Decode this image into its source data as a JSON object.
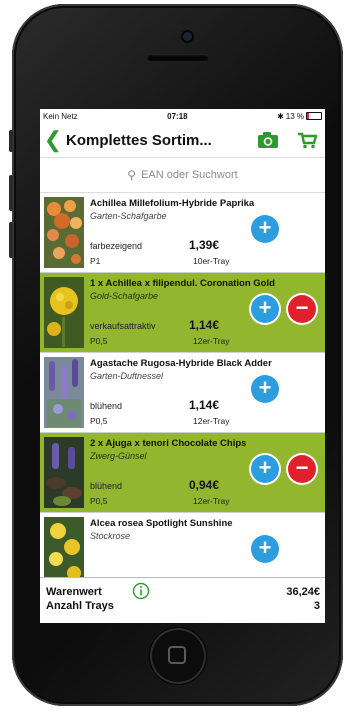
{
  "status": {
    "carrier": "Kein Netz",
    "time": "07:18",
    "battery": "13 %"
  },
  "nav": {
    "back_icon": "chevron-left-icon",
    "title": "Komplettes Sortim...",
    "camera_icon": "camera-icon",
    "cart_icon": "cart-icon"
  },
  "search": {
    "placeholder": "EAN oder Suchwort"
  },
  "items": [
    {
      "name": "Achillea Millefolium-Hybride Paprika",
      "sub": "Garten-Schafgarbe",
      "attr": "farbezeigend",
      "price": "1,39€",
      "code": "P1",
      "tray": "10er-Tray",
      "selected": false
    },
    {
      "name": "1 x Achillea x filipendul. Coronation Gold",
      "sub": "Gold-Schafgarbe",
      "attr": "verkaufsattraktiv",
      "price": "1,14€",
      "code": "P0,5",
      "tray": "12er-Tray",
      "selected": true
    },
    {
      "name": "Agastache Rugosa-Hybride Black Adder",
      "sub": "Garten-Duftnessel",
      "attr": "blühend",
      "price": "1,14€",
      "code": "P0,5",
      "tray": "12er-Tray",
      "selected": false
    },
    {
      "name": "2 x Ajuga x tenori Chocolate Chips",
      "sub": "Zwerg-Günsel",
      "attr": "blühend",
      "price": "0,94€",
      "code": "P0,5",
      "tray": "12er-Tray",
      "selected": true
    },
    {
      "name": "Alcea rosea Spotlight Sunshine",
      "sub": "Stockrose",
      "attr": "",
      "price": "",
      "code": "",
      "tray": "",
      "selected": false
    }
  ],
  "footer": {
    "warenwert_label": "Warenwert",
    "warenwert_value": "36,24€",
    "trays_label": "Anzahl Trays",
    "trays_value": "3"
  },
  "colors": {
    "accent_green": "#2d9c2d",
    "highlight_row": "#93b62f",
    "plus_blue": "#2a9ee0",
    "minus_red": "#e0202d"
  }
}
